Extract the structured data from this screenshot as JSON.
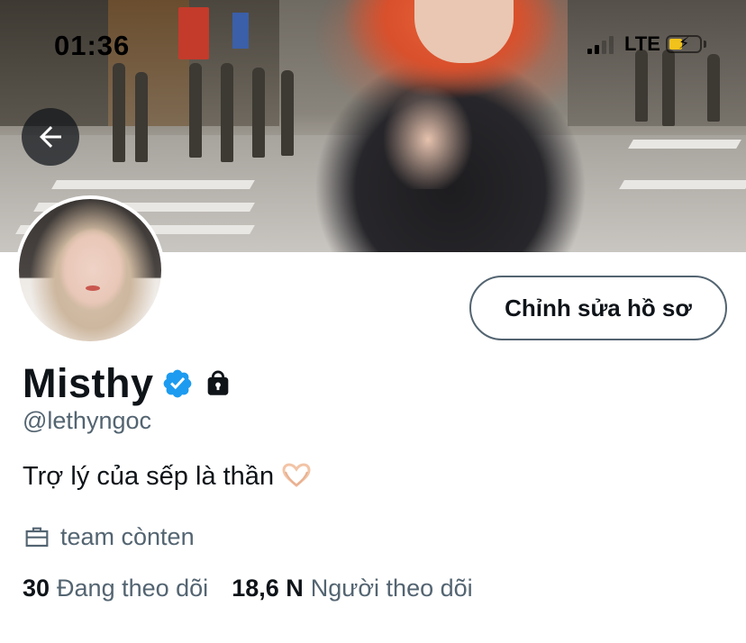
{
  "status_bar": {
    "time": "01:36",
    "network": "LTE",
    "battery_color": "#f1c21b"
  },
  "header": {
    "back_icon": "arrow-left-icon"
  },
  "profile": {
    "edit_button_label": "Chỉnh sửa hồ sơ",
    "display_name": "Misthy",
    "verified_icon": "verified-badge-icon",
    "protected_icon": "lock-icon",
    "handle": "@lethyngoc",
    "bio": "Trợ lý của sếp là thần",
    "bio_emoji": "heart-hands-emoji",
    "professional_category_icon": "briefcase-icon",
    "professional_category": "team cònten",
    "following_count": "30",
    "following_label": "Đang theo dõi",
    "followers_count": "18,6 N",
    "followers_label": "Người theo dõi"
  },
  "colors": {
    "text_primary": "#0f1419",
    "text_secondary": "#536471",
    "verified_blue": "#1d9bf0",
    "button_border": "#536471"
  }
}
